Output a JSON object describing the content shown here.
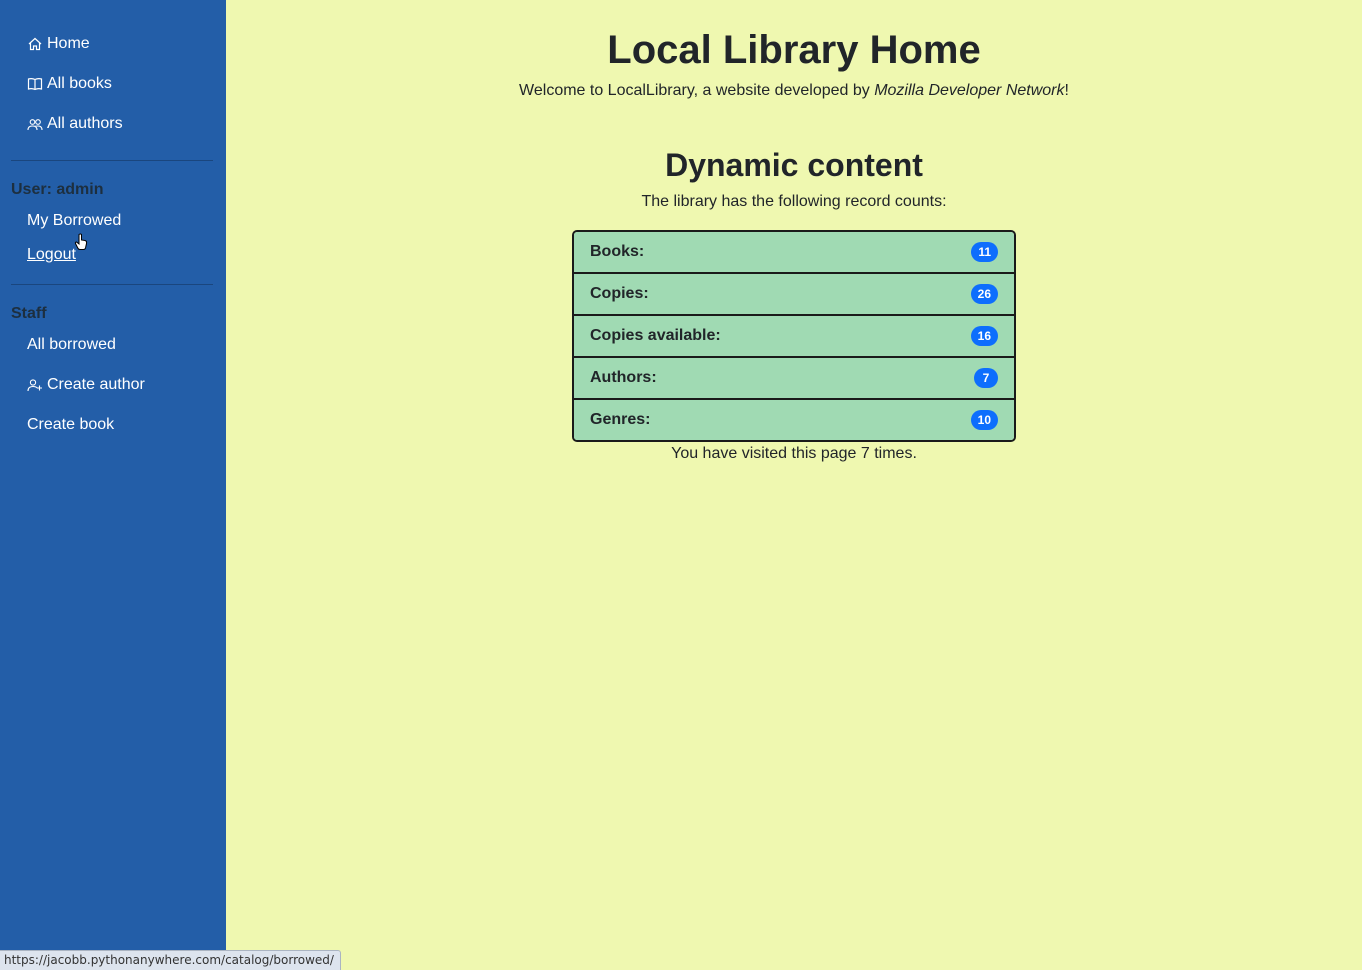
{
  "sidebar": {
    "nav": [
      {
        "label": "Home",
        "icon": "home-icon"
      },
      {
        "label": "All books",
        "icon": "book-icon"
      },
      {
        "label": "All authors",
        "icon": "people-icon"
      }
    ],
    "user_label": "User: admin",
    "user_items": {
      "my_borrowed": "My Borrowed",
      "logout": "Logout"
    },
    "staff_label": "Staff",
    "staff_items": {
      "all_borrowed": "All borrowed",
      "create_author": "Create author",
      "create_book": "Create book"
    }
  },
  "main": {
    "title": "Local Library Home",
    "welcome_prefix": "Welcome to LocalLibrary, a website developed by ",
    "welcome_emphasis": "Mozilla Developer Network",
    "welcome_suffix": "!",
    "dynamic_title": "Dynamic content",
    "counts_intro": "The library has the following record counts:",
    "counts": [
      {
        "label": "Books:",
        "value": "11"
      },
      {
        "label": "Copies:",
        "value": "26"
      },
      {
        "label": "Copies available:",
        "value": "16"
      },
      {
        "label": "Authors:",
        "value": "7"
      },
      {
        "label": "Genres:",
        "value": "10"
      }
    ],
    "visits_text": "You have visited this page 7 times."
  },
  "status_bar": {
    "url": "https://jacobb.pythonanywhere.com/catalog/borrowed/"
  },
  "colors": {
    "sidebar": "#235ea8",
    "background": "#eff8b0",
    "row": "#a0dab3",
    "badge": "#0d6efd"
  }
}
